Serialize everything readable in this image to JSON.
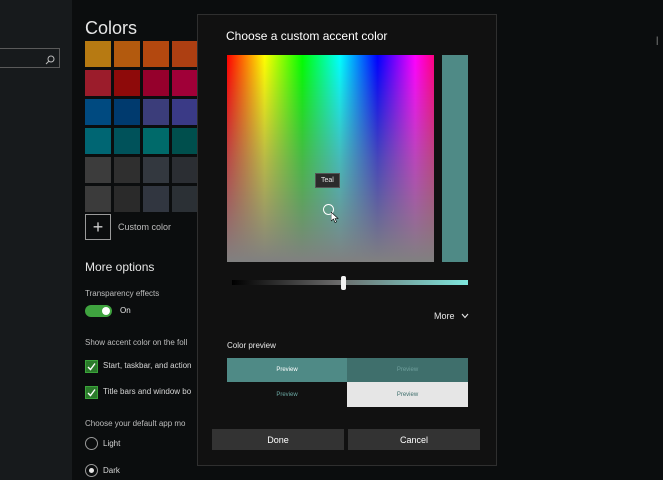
{
  "colors": {
    "swatches": [
      [
        "#b77a12",
        "#b35a0e",
        "#b3480f",
        "#ad3f12"
      ],
      [
        "#9b1c2b",
        "#8e0a0a",
        "#95002c",
        "#a00038"
      ],
      [
        "#004a80",
        "#003a6e",
        "#3b3d7a",
        "#3a3a86"
      ],
      [
        "#006673",
        "#00525a",
        "#006a6a",
        "#004f4d"
      ],
      [
        "#3c3c3c",
        "#2f2f2f",
        "#33383f",
        "#2b2e33"
      ],
      [
        "#3b3b3b",
        "#2a2a2a",
        "#313640",
        "#2b3035"
      ]
    ],
    "accent": "#4f8a86",
    "toggle_on": "#3fa33f"
  },
  "settings": {
    "title": "Colors",
    "custom_color_label": "Custom color",
    "more_options_heading": "More options",
    "transparency_label": "Transparency effects",
    "transparency_state": "On",
    "show_accent_label": "Show accent color on the foll",
    "start_taskbar_label": "Start, taskbar, and action",
    "title_bars_label": "Title bars and window bo",
    "app_mode_label": "Choose your default app mo",
    "light_label": "Light",
    "dark_label": "Dark"
  },
  "dialog": {
    "title": "Choose a custom accent color",
    "tooltip": "Teal",
    "more_label": "More",
    "preview_heading": "Color preview",
    "preview_text": "Preview",
    "done_label": "Done",
    "cancel_label": "Cancel"
  },
  "icons": {
    "search": "search-icon",
    "plus": "plus-icon",
    "chevron": "chevron-down-icon",
    "check": "check-icon",
    "cursor": "mouse-cursor-icon"
  }
}
